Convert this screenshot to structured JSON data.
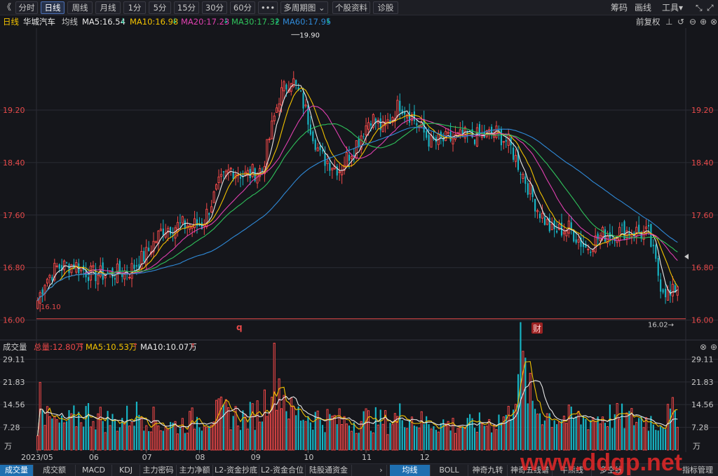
{
  "toolbar": {
    "back_label": "《",
    "buttons": [
      {
        "label": "分时",
        "x": 22,
        "w": 32
      },
      {
        "label": "日线",
        "x": 58,
        "w": 34,
        "active": true
      },
      {
        "label": "周线",
        "x": 96,
        "w": 36
      },
      {
        "label": "月线",
        "x": 136,
        "w": 36
      },
      {
        "label": "1分",
        "x": 176,
        "w": 32
      },
      {
        "label": "5分",
        "x": 212,
        "w": 32
      },
      {
        "label": "15分",
        "x": 248,
        "w": 36
      },
      {
        "label": "30分",
        "x": 288,
        "w": 36
      },
      {
        "label": "60分",
        "x": 328,
        "w": 36
      },
      {
        "label": "•••",
        "x": 368,
        "w": 28
      },
      {
        "label": "多周期图 ⌄",
        "x": 400,
        "w": 68
      },
      {
        "label": "个股资料",
        "x": 474,
        "w": 54
      },
      {
        "label": "诊股",
        "x": 532,
        "w": 36
      }
    ],
    "right_items": [
      "筹码",
      "画线",
      "工具▾"
    ],
    "window_icons": [
      "⤡",
      "⤢"
    ]
  },
  "header": {
    "period": "日线",
    "stock_name": "华城汽车",
    "indicator": "均线",
    "ma5": "MA5:16.54",
    "ma10": "MA10:16.98",
    "ma20": "MA20:17.23",
    "ma30": "MA30:17.32",
    "ma60": "MA60:17.95",
    "fq": "前复权"
  },
  "volume_header": {
    "title": "成交量",
    "total": "总量:12.80万",
    "ma5": "MA5:10.53万",
    "ma10": "MA10:10.07万"
  },
  "markers": {
    "high_label": "19.90",
    "low_label_left": "16.10",
    "low_label_right": "16.02",
    "mark_q": "q",
    "mark_cai": "财"
  },
  "tabs_left": [
    "成交量",
    "成交额",
    "MACD",
    "KDJ",
    "主力密码",
    "主力净额",
    "L2-资金抄底",
    "L2-资金合位",
    "陆股通资金"
  ],
  "tabs_right": [
    "均线",
    "BOLL",
    "神奇九转",
    "神奇五线谱",
    "牛熊线",
    "多空线"
  ],
  "tabs_far_right": "指标管理",
  "watermark": "www.ddgp.net",
  "colors": {
    "up": "#f04848",
    "down": "#17b6c6",
    "ma5": "#e8e8e8",
    "ma10": "#f2c200",
    "ma20": "#e040b0",
    "ma30": "#2fc25b",
    "ma60": "#2f8ad8",
    "axis_red": "#e84a4a"
  },
  "chart_data": {
    "type": "candlestick",
    "price_axis": {
      "ticks": [
        16.0,
        16.8,
        17.6,
        18.4,
        19.2
      ],
      "tick_labels": [
        "16.00",
        "16.80",
        "17.60",
        "18.40",
        "19.20"
      ],
      "ylim": [
        16.0,
        19.2
      ]
    },
    "volume_axis": {
      "ticks": [
        7.28,
        14.56,
        21.83,
        29.11
      ],
      "tick_labels": [
        "7.28",
        "14.56",
        "21.83",
        "29.11"
      ],
      "unit": "万"
    },
    "x_labels": [
      "2023/05",
      "06",
      "07",
      "08",
      "09",
      "10",
      "11",
      "12"
    ],
    "anchors_price": [
      [
        0,
        16.3
      ],
      [
        3,
        16.6
      ],
      [
        8,
        16.8
      ],
      [
        15,
        16.85
      ],
      [
        22,
        16.7
      ],
      [
        30,
        16.7
      ],
      [
        38,
        16.75
      ],
      [
        45,
        17.0
      ],
      [
        52,
        17.4
      ],
      [
        60,
        17.45
      ],
      [
        68,
        17.45
      ],
      [
        75,
        18.05
      ],
      [
        80,
        18.3
      ],
      [
        86,
        18.2
      ],
      [
        93,
        18.3
      ],
      [
        100,
        19.4
      ],
      [
        105,
        19.7
      ],
      [
        110,
        19.3
      ],
      [
        117,
        18.5
      ],
      [
        125,
        18.3
      ],
      [
        132,
        18.7
      ],
      [
        138,
        19.1
      ],
      [
        143,
        18.9
      ],
      [
        150,
        19.3
      ],
      [
        155,
        19.1
      ],
      [
        163,
        18.7
      ],
      [
        170,
        18.75
      ],
      [
        177,
        18.8
      ],
      [
        184,
        18.8
      ],
      [
        190,
        18.85
      ],
      [
        195,
        18.7
      ],
      [
        200,
        18.3
      ],
      [
        207,
        17.7
      ],
      [
        213,
        17.35
      ],
      [
        220,
        17.4
      ],
      [
        227,
        17.1
      ],
      [
        234,
        17.3
      ],
      [
        241,
        17.35
      ],
      [
        248,
        17.35
      ],
      [
        253,
        17.3
      ],
      [
        258,
        16.55
      ],
      [
        262,
        16.35
      ],
      [
        265,
        16.55
      ]
    ],
    "anchors_volume": [
      [
        0,
        7
      ],
      [
        1,
        29
      ],
      [
        3,
        10
      ],
      [
        10,
        8
      ],
      [
        20,
        12
      ],
      [
        27,
        10
      ],
      [
        33,
        9
      ],
      [
        42,
        12
      ],
      [
        52,
        8
      ],
      [
        58,
        8
      ],
      [
        66,
        10
      ],
      [
        77,
        12
      ],
      [
        86,
        10
      ],
      [
        93,
        13
      ],
      [
        98,
        25
      ],
      [
        105,
        12
      ],
      [
        112,
        11
      ],
      [
        120,
        10
      ],
      [
        128,
        9
      ],
      [
        136,
        10
      ],
      [
        145,
        9
      ],
      [
        152,
        12
      ],
      [
        158,
        9
      ],
      [
        165,
        9
      ],
      [
        172,
        8
      ],
      [
        180,
        8
      ],
      [
        188,
        9
      ],
      [
        195,
        11
      ],
      [
        200,
        30
      ],
      [
        205,
        14
      ],
      [
        212,
        11
      ],
      [
        220,
        10
      ],
      [
        228,
        10
      ],
      [
        236,
        11
      ],
      [
        245,
        10
      ],
      [
        252,
        10
      ],
      [
        258,
        9
      ],
      [
        265,
        12.8
      ]
    ],
    "ma_last": {
      "MA5": 16.54,
      "MA10": 16.98,
      "MA20": 17.23,
      "MA30": 17.32,
      "MA60": 17.95
    },
    "volume_ma_last": {
      "MA5": 10.53,
      "MA10": 10.07
    }
  }
}
